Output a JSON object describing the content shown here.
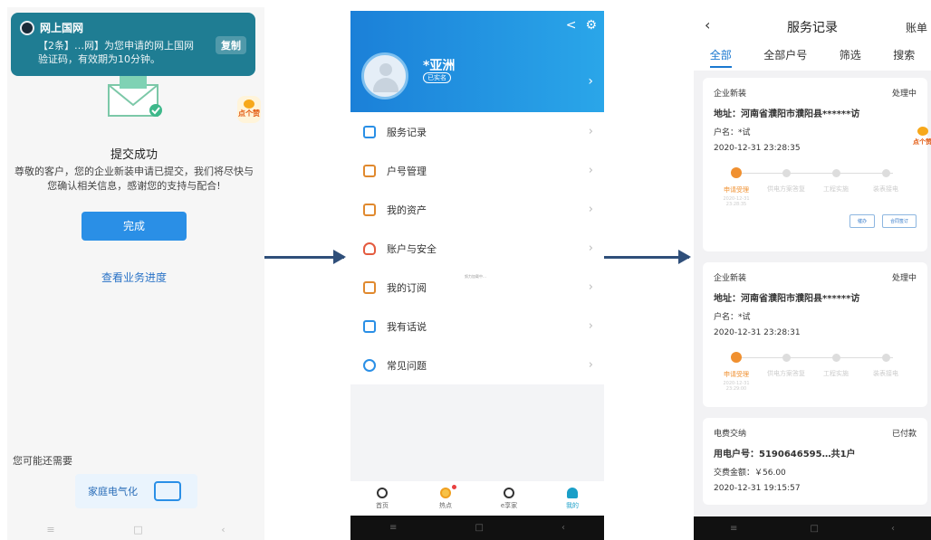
{
  "screen1": {
    "notification": {
      "app": "网上国网",
      "body": "【2条】…网】为您申请的网上国网验证码，有效期为10分钟。",
      "copy_label": "复制"
    },
    "helper_label": "点个赞",
    "title": "提交成功",
    "description": "尊敬的客户，您的企业新装申请已提交，我们将尽快与您确认相关信息，感谢您的支持与配合!",
    "done_button": "完成",
    "progress_link": "查看业务进度",
    "also_need": "您可能还需要",
    "promo": "家庭电气化",
    "nav": [
      "≡",
      "□",
      "‹"
    ]
  },
  "screen2": {
    "username": "*亚洲",
    "badge": "已实名",
    "menu": [
      {
        "label": "服务记录",
        "icon": "record-icon"
      },
      {
        "label": "户号管理",
        "icon": "account-number-icon"
      },
      {
        "label": "我的资产",
        "icon": "assets-icon"
      },
      {
        "label": "账户与安全",
        "icon": "shield-icon"
      },
      {
        "label": "我的订阅",
        "icon": "subscription-icon"
      },
      {
        "label": "我有话说",
        "icon": "feedback-icon"
      },
      {
        "label": "常见问题",
        "icon": "question-icon"
      }
    ],
    "loading_text": "努力加载中…",
    "tabs": [
      "首页",
      "热点",
      "e享家",
      "我的"
    ],
    "nav": [
      "≡",
      "□",
      "‹"
    ]
  },
  "screen3": {
    "back": "‹",
    "title": "服务记录",
    "bill": "账单",
    "tabs": [
      "全部",
      "全部户号",
      "筛选",
      "搜索"
    ],
    "helper_label": "点个赞",
    "cards": [
      {
        "type": "企业新装",
        "status": "处理中",
        "address": "地址：河南省濮阳市濮阳县******访",
        "account_name": "户名：*试",
        "time": "2020-12-31 23:28:35",
        "steps": [
          "申请受理",
          "供电方案答复",
          "工程实施",
          "装表接电"
        ],
        "step_time": "2020-12-31 23:28:35",
        "buttons": [
          "催办",
          "合同签订"
        ]
      },
      {
        "type": "企业新装",
        "status": "处理中",
        "address": "地址：河南省濮阳市濮阳县******访",
        "account_name": "户名：*试",
        "time": "2020-12-31 23:28:31",
        "steps": [
          "申请受理",
          "供电方案答复",
          "工程实施",
          "装表接电"
        ],
        "step_time": "2020-12-31 23:29:00"
      },
      {
        "type": "电费交纳",
        "status": "已付款",
        "account_number": "用电户号：5190646595…共1户",
        "amount": "交费金额：￥56.00",
        "time": "2020-12-31 19:15:57"
      }
    ],
    "nav": [
      "≡",
      "□",
      "‹"
    ]
  }
}
